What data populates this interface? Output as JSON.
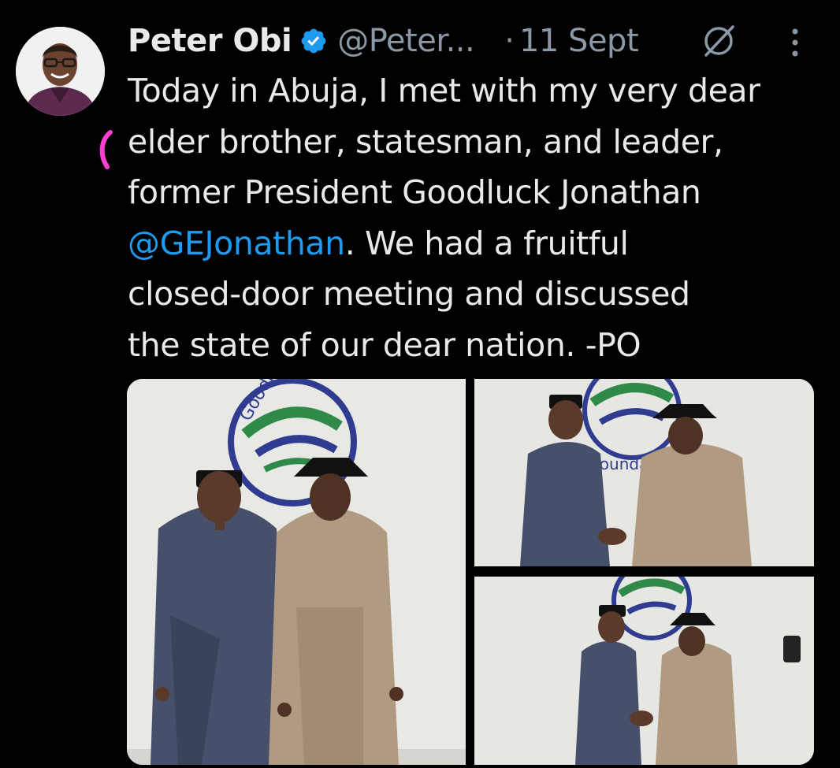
{
  "tweet": {
    "display_name": "Peter Obi",
    "handle": "@Peter...",
    "separator": "·",
    "date": "11 Sept",
    "text_lines": [
      "Today in Abuja, I met with my very dear",
      "elder brother, statesman, and leader,",
      "former President Goodluck Jonathan"
    ],
    "mention": "@GEJonathan",
    "text_after_mention": ". We had a fruitful",
    "text_lines_end": [
      "closed-door meeting and discussed",
      "the state of our dear nation. -PO"
    ]
  },
  "colors": {
    "background": "#000000",
    "text": "#e7e9ea",
    "secondary": "#8b98a5",
    "link": "#1d9bf0",
    "verified": "#1d9bf0",
    "highlight_mark": "#ff3fd2"
  },
  "icons": {
    "verified": "verified-badge-icon",
    "grok": "grok-icon",
    "more": "more-vertical-icon"
  },
  "media": {
    "photo_count": 3,
    "logo_text_1": "Goodluck Jonathan",
    "logo_text_2": "Foundation"
  }
}
